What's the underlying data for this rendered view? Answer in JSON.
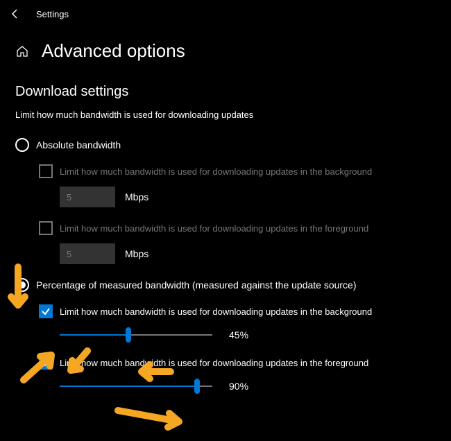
{
  "header": {
    "app_title": "Settings"
  },
  "page": {
    "title": "Advanced options"
  },
  "section": {
    "title": "Download settings",
    "desc": "Limit how much bandwidth is used for downloading updates"
  },
  "radio": {
    "absolute": "Absolute bandwidth",
    "percentage": "Percentage of measured bandwidth (measured against the update source)"
  },
  "absolute": {
    "bg_label": "Limit how much bandwidth is used for downloading updates in the background",
    "bg_value": "5",
    "bg_unit": "Mbps",
    "fg_label": "Limit how much bandwidth is used for downloading updates in the foreground",
    "fg_value": "5",
    "fg_unit": "Mbps"
  },
  "percentage": {
    "bg_label": "Limit how much bandwidth is used for downloading updates in the background",
    "bg_value": "45%",
    "bg_percent": 45,
    "fg_label": "Limit how much bandwidth is used for downloading updates in the foreground",
    "fg_value": "90%",
    "fg_percent": 90
  }
}
